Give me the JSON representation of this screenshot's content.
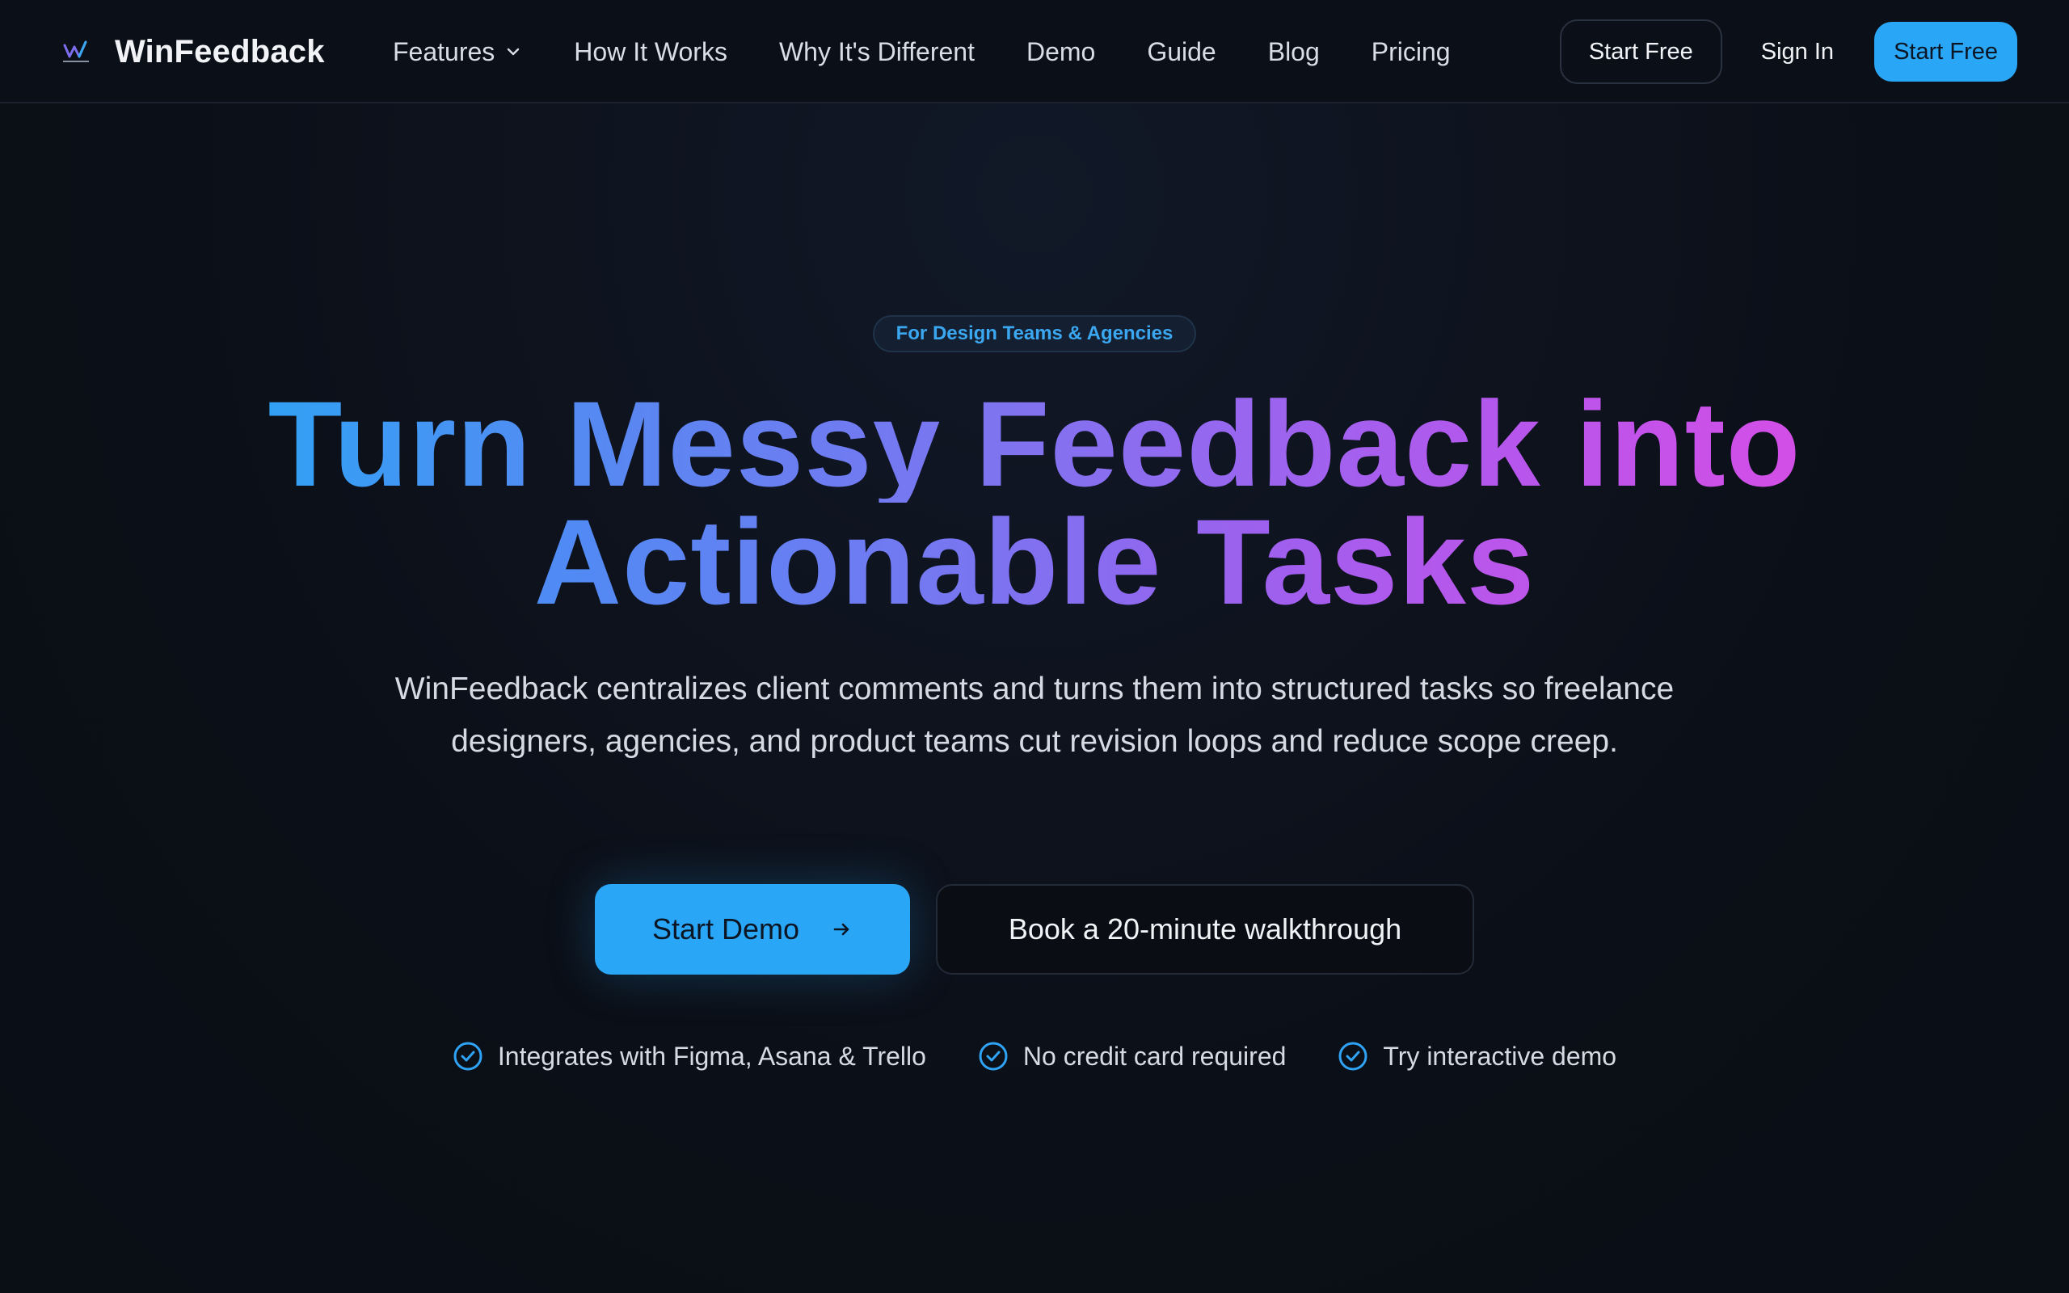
{
  "brand": {
    "name": "WinFeedback",
    "logo_icon": "winfeedback-logo-icon",
    "logo_text": "WinFeedback"
  },
  "nav": {
    "items": [
      {
        "label": "Features",
        "has_dropdown": true
      },
      {
        "label": "How It Works"
      },
      {
        "label": "Why It's Different"
      },
      {
        "label": "Demo"
      },
      {
        "label": "Guide"
      },
      {
        "label": "Blog"
      },
      {
        "label": "Pricing"
      }
    ],
    "start_free_outline": "Start Free",
    "sign_in": "Sign In",
    "start_free_primary": "Start Free"
  },
  "hero": {
    "badge": "For Design Teams & Agencies",
    "headline_line1": "Turn Messy Feedback into",
    "headline_line2": "Actionable Tasks",
    "subtitle": "WinFeedback centralizes client comments and turns them into structured tasks so freelance designers, agencies, and product teams cut revision loops and reduce scope creep.",
    "primary_cta": "Start Demo",
    "secondary_cta": "Book a 20-minute walkthrough",
    "features": [
      "Integrates with Figma, Asana & Trello",
      "No credit card required",
      "Try interactive demo"
    ]
  },
  "colors": {
    "accent": "#29a6f5",
    "background": "#0b0f17",
    "gradient_start": "#2fa3f5",
    "gradient_end": "#d64ee6"
  }
}
